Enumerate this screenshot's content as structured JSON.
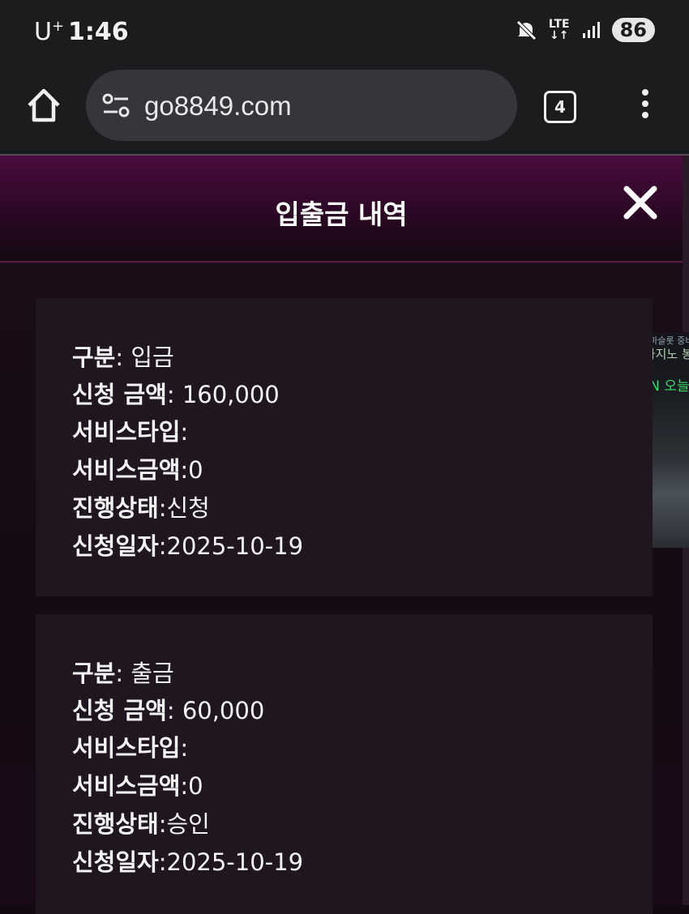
{
  "status_bar": {
    "carrier": "U",
    "carrier_sup": "+",
    "time": "1:46",
    "network": "LTE",
    "battery": "86"
  },
  "browser": {
    "url": "go8849.com",
    "tab_count": "4"
  },
  "modal": {
    "title": "입출금 내역"
  },
  "side_ad": {
    "line1": "프라마슬롯 중비",
    "line2": "텐카지노 봉",
    "line3": "SLN 오늘"
  },
  "records": [
    {
      "type_label": "구분",
      "type_value": ": 입금",
      "amount_label": "신청 금액",
      "amount_value": ": 160,000",
      "service_type_label": "서비스타입",
      "service_type_value": ":",
      "service_amount_label": "서비스금액",
      "service_amount_value": ":0",
      "status_label": "진행상태",
      "status_value": ":신청",
      "date_label": "신청일자",
      "date_value": ":2025-10-19"
    },
    {
      "type_label": "구분",
      "type_value": ": 출금",
      "amount_label": "신청 금액",
      "amount_value": ": 60,000",
      "service_type_label": "서비스타입",
      "service_type_value": ":",
      "service_amount_label": "서비스금액",
      "service_amount_value": ":0",
      "status_label": "진행상태",
      "status_value": ":승인",
      "date_label": "신청일자",
      "date_value": ":2025-10-19"
    }
  ]
}
